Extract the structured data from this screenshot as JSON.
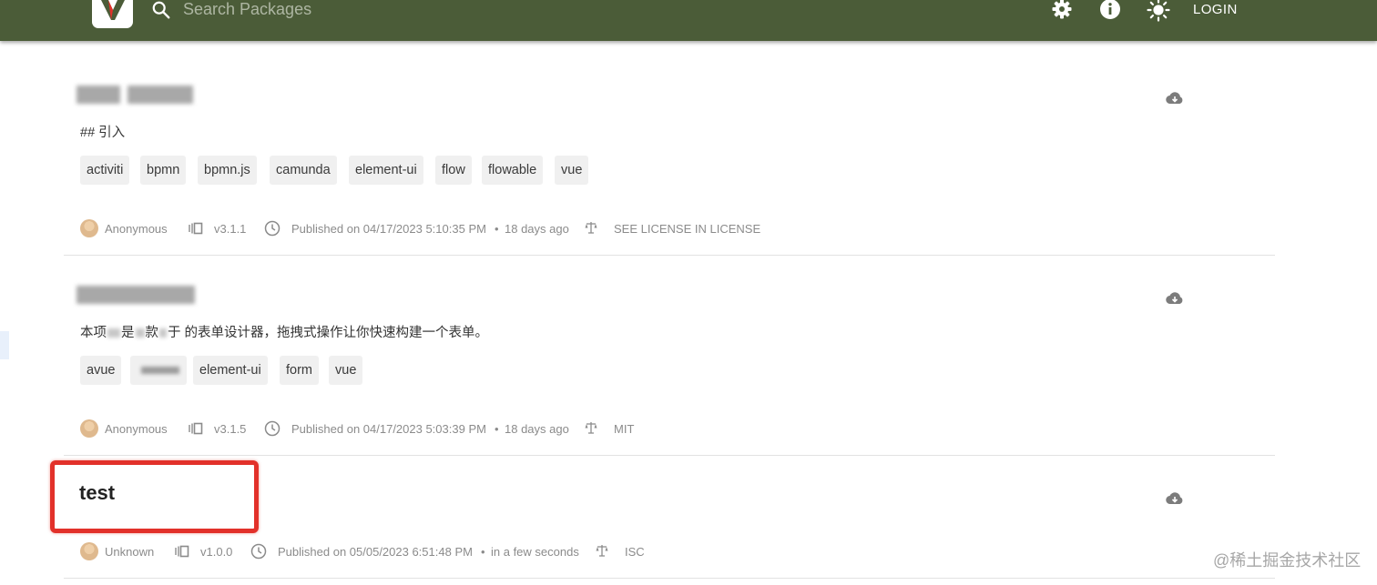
{
  "header": {
    "search_placeholder": "Search Packages",
    "login_label": "LOGIN",
    "icons": [
      "settings-icon",
      "info-icon",
      "theme-toggle-icon"
    ],
    "colors": {
      "bar": "#4b5c38",
      "accent": "#e2312a"
    }
  },
  "packages": [
    {
      "description": "## 引入",
      "tags": [
        "activiti",
        "bpmn",
        "bpmn.js",
        "camunda",
        "element-ui",
        "flow",
        "flowable",
        "vue"
      ],
      "author": "Anonymous",
      "version": "v3.1.1",
      "published": "Published on 04/17/2023 5:10:35 PM",
      "relative": "18 days ago",
      "license": "SEE LICENSE IN LICENSE"
    },
    {
      "description_parts": [
        "本项",
        "是",
        "款",
        "于 的表单设计器，拖拽式操作让你快速构建一个表单。"
      ],
      "tags": [
        "avue",
        "",
        "element-ui",
        "form",
        "vue"
      ],
      "author": "Anonymous",
      "version": "v3.1.5",
      "published": "Published on 04/17/2023 5:03:39 PM",
      "relative": "18 days ago",
      "license": "MIT"
    },
    {
      "title": "test",
      "author": "Unknown",
      "version": "v1.0.0",
      "published": "Published on 05/05/2023 6:51:48 PM",
      "relative": "in a few seconds",
      "license": "ISC"
    }
  ],
  "meta_separator": "•",
  "watermark": "@稀土掘金技术社区"
}
